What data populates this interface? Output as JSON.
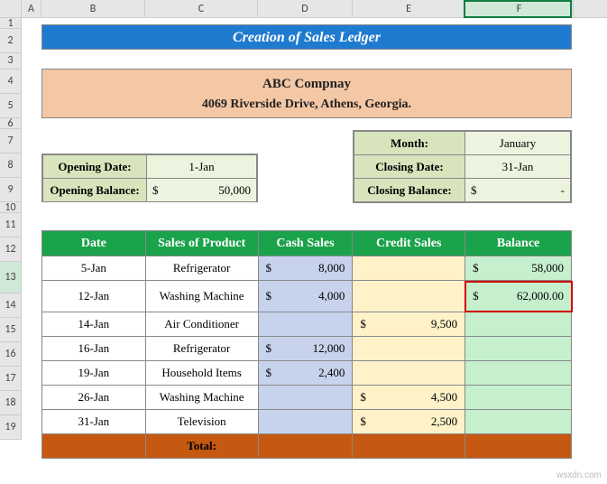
{
  "columns": [
    "A",
    "B",
    "C",
    "D",
    "E",
    "F"
  ],
  "rows": [
    "1",
    "2",
    "3",
    "4",
    "5",
    "6",
    "7",
    "8",
    "9",
    "10",
    "11",
    "12",
    "13",
    "14",
    "15",
    "16",
    "17",
    "18",
    "19"
  ],
  "title": "Creation of Sales Ledger",
  "company": {
    "name": "ABC Compnay",
    "address": "4069 Riverside Drive, Athens, Georgia."
  },
  "opening": {
    "date_label": "Opening Date:",
    "date_value": "1-Jan",
    "balance_label": "Opening Balance:",
    "balance_sym": "$",
    "balance_value": "50,000"
  },
  "closing": {
    "month_label": "Month:",
    "month_value": "January",
    "date_label": "Closing Date:",
    "date_value": "31-Jan",
    "balance_label": "Closing Balance:",
    "balance_sym": "$",
    "balance_value": "-"
  },
  "ledger": {
    "headers": [
      "Date",
      "Sales of Product",
      "Cash Sales",
      "Credit Sales",
      "Balance"
    ],
    "rows": [
      {
        "date": "5-Jan",
        "product": "Refrigerator",
        "cash_sym": "$",
        "cash": "8,000",
        "credit_sym": "",
        "credit": "",
        "bal_sym": "$",
        "bal": "58,000"
      },
      {
        "date": "12-Jan",
        "product": "Washing Machine",
        "cash_sym": "$",
        "cash": "4,000",
        "credit_sym": "",
        "credit": "",
        "bal_sym": "$",
        "bal": "62,000.00"
      },
      {
        "date": "14-Jan",
        "product": "Air Conditioner",
        "cash_sym": "",
        "cash": "",
        "credit_sym": "$",
        "credit": "9,500",
        "bal_sym": "",
        "bal": ""
      },
      {
        "date": "16-Jan",
        "product": "Refrigerator",
        "cash_sym": "$",
        "cash": "12,000",
        "credit_sym": "",
        "credit": "",
        "bal_sym": "",
        "bal": ""
      },
      {
        "date": "19-Jan",
        "product": "Household Items",
        "cash_sym": "$",
        "cash": "2,400",
        "credit_sym": "",
        "credit": "",
        "bal_sym": "",
        "bal": ""
      },
      {
        "date": "26-Jan",
        "product": "Washing Machine",
        "cash_sym": "",
        "cash": "",
        "credit_sym": "$",
        "credit": "4,500",
        "bal_sym": "",
        "bal": ""
      },
      {
        "date": "31-Jan",
        "product": "Television",
        "cash_sym": "",
        "cash": "",
        "credit_sym": "$",
        "credit": "2,500",
        "bal_sym": "",
        "bal": ""
      }
    ],
    "total_label": "Total:"
  },
  "watermark": "wsxdn.com"
}
